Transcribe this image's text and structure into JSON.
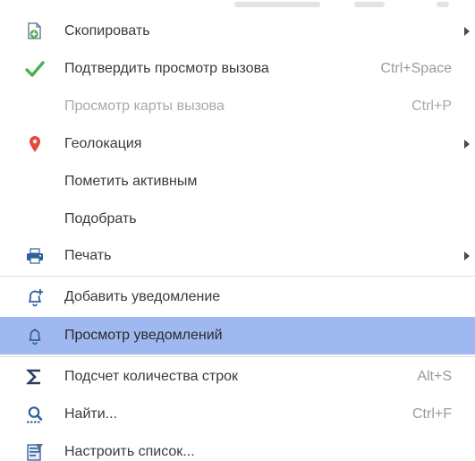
{
  "menu": {
    "items": [
      {
        "label": "Скопировать",
        "icon": "copy-add-icon",
        "has_submenu": true
      },
      {
        "label": "Подтвердить просмотр вызова",
        "icon": "checkmark-icon",
        "shortcut": "Ctrl+Space"
      },
      {
        "label": "Просмотр карты вызова",
        "shortcut": "Ctrl+P",
        "disabled": true
      },
      {
        "label": "Геолокация",
        "icon": "location-pin-icon",
        "has_submenu": true
      },
      {
        "label": "Пометить активным"
      },
      {
        "label": "Подобрать"
      },
      {
        "label": "Печать",
        "icon": "printer-icon",
        "has_submenu": true
      },
      {
        "label": "Добавить уведомление",
        "icon": "bell-add-icon"
      },
      {
        "label": "Просмотр уведомлений",
        "icon": "bell-icon",
        "highlighted": true
      },
      {
        "label": "Подсчет количества строк",
        "icon": "sigma-icon",
        "shortcut": "Alt+S"
      },
      {
        "label": "Найти...",
        "icon": "search-icon",
        "shortcut": "Ctrl+F"
      },
      {
        "label": "Настроить список...",
        "icon": "list-settings-icon"
      }
    ]
  },
  "colors": {
    "highlight": "#9fb8ef",
    "text": "#3a3a3a",
    "shortcut": "#9a9a9a",
    "disabled": "#a9a9a9",
    "icon_blue": "#2f5f9e",
    "icon_green": "#4caf50",
    "icon_red": "#e24a3b"
  }
}
